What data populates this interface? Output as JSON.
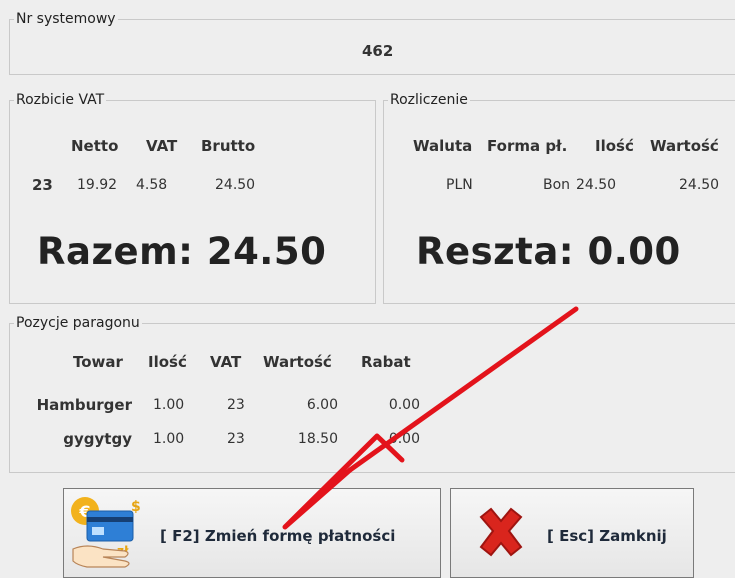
{
  "system_number": {
    "label": "Nr systemowy",
    "value": "462"
  },
  "vat_breakdown": {
    "label": "Rozbicie VAT",
    "headers": [
      "Netto",
      "VAT",
      "Brutto"
    ],
    "row": {
      "rate": "23",
      "net": "19.92",
      "vat": "4.58",
      "gross": "24.50"
    },
    "total": "Razem: 24.50"
  },
  "settlement": {
    "label": "Rozliczenie",
    "headers": [
      "Waluta",
      "Forma pł.",
      "Ilość",
      "Wartość"
    ],
    "row": {
      "currency": "PLN",
      "form": "Bon",
      "quantity": "24.50",
      "value": "24.50"
    },
    "change": "Reszta: 0.00"
  },
  "receipt_items": {
    "label": "Pozycje paragonu",
    "headers": [
      "Towar",
      "Ilość",
      "VAT",
      "Wartość",
      "Rabat"
    ],
    "rows": [
      {
        "product": "Hamburger",
        "qty": "1.00",
        "vat": "23",
        "value": "6.00",
        "discount": "0.00"
      },
      {
        "product": "gygytgy",
        "qty": "1.00",
        "vat": "23",
        "value": "18.50",
        "discount": "0.00"
      }
    ]
  },
  "buttons": {
    "change_payment": "[ F2] Zmień formę płatności",
    "close": "[ Esc] Zamknij"
  },
  "icons": {
    "payment": "payment-card-hand-icon",
    "close": "red-x-icon",
    "annotation": "red-arrow-annotation"
  },
  "colors": {
    "annotation_arrow": "#e3131b",
    "close_x": "#d9251d"
  }
}
